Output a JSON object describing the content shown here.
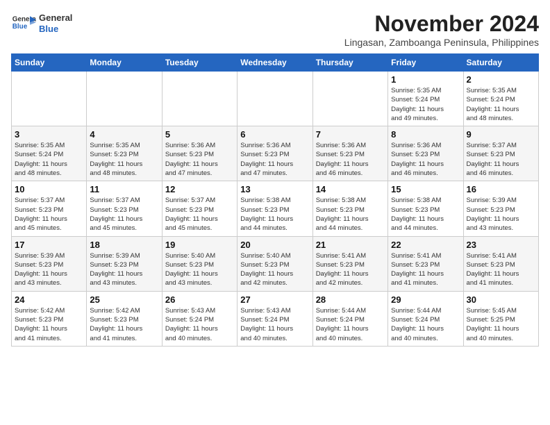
{
  "header": {
    "logo_line1": "General",
    "logo_line2": "Blue",
    "month": "November 2024",
    "location": "Lingasan, Zamboanga Peninsula, Philippines"
  },
  "days_of_week": [
    "Sunday",
    "Monday",
    "Tuesday",
    "Wednesday",
    "Thursday",
    "Friday",
    "Saturday"
  ],
  "weeks": [
    [
      {
        "day": "",
        "info": ""
      },
      {
        "day": "",
        "info": ""
      },
      {
        "day": "",
        "info": ""
      },
      {
        "day": "",
        "info": ""
      },
      {
        "day": "",
        "info": ""
      },
      {
        "day": "1",
        "info": "Sunrise: 5:35 AM\nSunset: 5:24 PM\nDaylight: 11 hours\nand 49 minutes."
      },
      {
        "day": "2",
        "info": "Sunrise: 5:35 AM\nSunset: 5:24 PM\nDaylight: 11 hours\nand 48 minutes."
      }
    ],
    [
      {
        "day": "3",
        "info": "Sunrise: 5:35 AM\nSunset: 5:24 PM\nDaylight: 11 hours\nand 48 minutes."
      },
      {
        "day": "4",
        "info": "Sunrise: 5:35 AM\nSunset: 5:23 PM\nDaylight: 11 hours\nand 48 minutes."
      },
      {
        "day": "5",
        "info": "Sunrise: 5:36 AM\nSunset: 5:23 PM\nDaylight: 11 hours\nand 47 minutes."
      },
      {
        "day": "6",
        "info": "Sunrise: 5:36 AM\nSunset: 5:23 PM\nDaylight: 11 hours\nand 47 minutes."
      },
      {
        "day": "7",
        "info": "Sunrise: 5:36 AM\nSunset: 5:23 PM\nDaylight: 11 hours\nand 46 minutes."
      },
      {
        "day": "8",
        "info": "Sunrise: 5:36 AM\nSunset: 5:23 PM\nDaylight: 11 hours\nand 46 minutes."
      },
      {
        "day": "9",
        "info": "Sunrise: 5:37 AM\nSunset: 5:23 PM\nDaylight: 11 hours\nand 46 minutes."
      }
    ],
    [
      {
        "day": "10",
        "info": "Sunrise: 5:37 AM\nSunset: 5:23 PM\nDaylight: 11 hours\nand 45 minutes."
      },
      {
        "day": "11",
        "info": "Sunrise: 5:37 AM\nSunset: 5:23 PM\nDaylight: 11 hours\nand 45 minutes."
      },
      {
        "day": "12",
        "info": "Sunrise: 5:37 AM\nSunset: 5:23 PM\nDaylight: 11 hours\nand 45 minutes."
      },
      {
        "day": "13",
        "info": "Sunrise: 5:38 AM\nSunset: 5:23 PM\nDaylight: 11 hours\nand 44 minutes."
      },
      {
        "day": "14",
        "info": "Sunrise: 5:38 AM\nSunset: 5:23 PM\nDaylight: 11 hours\nand 44 minutes."
      },
      {
        "day": "15",
        "info": "Sunrise: 5:38 AM\nSunset: 5:23 PM\nDaylight: 11 hours\nand 44 minutes."
      },
      {
        "day": "16",
        "info": "Sunrise: 5:39 AM\nSunset: 5:23 PM\nDaylight: 11 hours\nand 43 minutes."
      }
    ],
    [
      {
        "day": "17",
        "info": "Sunrise: 5:39 AM\nSunset: 5:23 PM\nDaylight: 11 hours\nand 43 minutes."
      },
      {
        "day": "18",
        "info": "Sunrise: 5:39 AM\nSunset: 5:23 PM\nDaylight: 11 hours\nand 43 minutes."
      },
      {
        "day": "19",
        "info": "Sunrise: 5:40 AM\nSunset: 5:23 PM\nDaylight: 11 hours\nand 43 minutes."
      },
      {
        "day": "20",
        "info": "Sunrise: 5:40 AM\nSunset: 5:23 PM\nDaylight: 11 hours\nand 42 minutes."
      },
      {
        "day": "21",
        "info": "Sunrise: 5:41 AM\nSunset: 5:23 PM\nDaylight: 11 hours\nand 42 minutes."
      },
      {
        "day": "22",
        "info": "Sunrise: 5:41 AM\nSunset: 5:23 PM\nDaylight: 11 hours\nand 41 minutes."
      },
      {
        "day": "23",
        "info": "Sunrise: 5:41 AM\nSunset: 5:23 PM\nDaylight: 11 hours\nand 41 minutes."
      }
    ],
    [
      {
        "day": "24",
        "info": "Sunrise: 5:42 AM\nSunset: 5:23 PM\nDaylight: 11 hours\nand 41 minutes."
      },
      {
        "day": "25",
        "info": "Sunrise: 5:42 AM\nSunset: 5:23 PM\nDaylight: 11 hours\nand 41 minutes."
      },
      {
        "day": "26",
        "info": "Sunrise: 5:43 AM\nSunset: 5:24 PM\nDaylight: 11 hours\nand 40 minutes."
      },
      {
        "day": "27",
        "info": "Sunrise: 5:43 AM\nSunset: 5:24 PM\nDaylight: 11 hours\nand 40 minutes."
      },
      {
        "day": "28",
        "info": "Sunrise: 5:44 AM\nSunset: 5:24 PM\nDaylight: 11 hours\nand 40 minutes."
      },
      {
        "day": "29",
        "info": "Sunrise: 5:44 AM\nSunset: 5:24 PM\nDaylight: 11 hours\nand 40 minutes."
      },
      {
        "day": "30",
        "info": "Sunrise: 5:45 AM\nSunset: 5:25 PM\nDaylight: 11 hours\nand 40 minutes."
      }
    ]
  ]
}
